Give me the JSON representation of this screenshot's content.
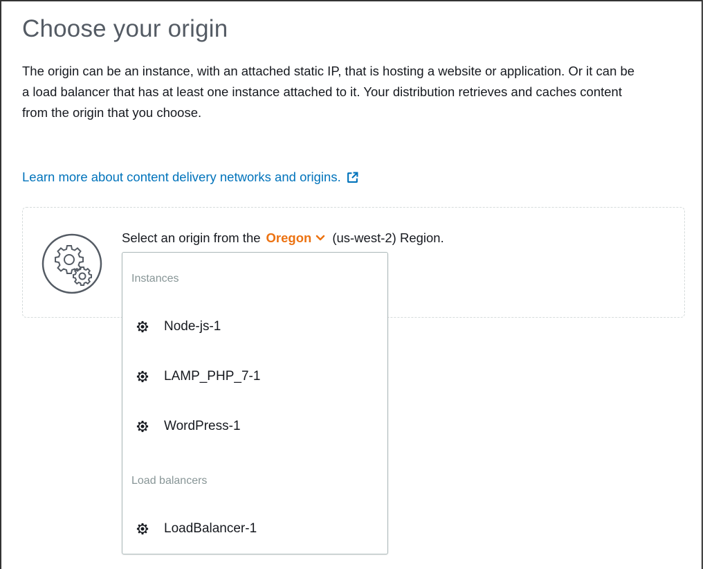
{
  "page": {
    "title": "Choose your origin",
    "description": "The origin can be an instance, with an attached static IP, that is hosting a website or application. Or it can be a load balancer that has at least one instance attached to it. Your distribution retrieves and caches content from the origin that you choose.",
    "learn_more_link": "Learn more about content delivery networks and origins."
  },
  "origin_selector": {
    "prefix": "Select an origin from the",
    "region_name": "Oregon",
    "suffix": "(us-west-2) Region.",
    "icon": "gears-icon"
  },
  "dropdown": {
    "groups": [
      {
        "label": "Instances",
        "options": [
          "Node-js-1",
          "LAMP_PHP_7-1",
          "WordPress-1"
        ]
      },
      {
        "label": "Load balancers",
        "options": [
          "LoadBalancer-1"
        ]
      }
    ],
    "option_icon": "gear-icon"
  },
  "colors": {
    "link": "#0073bb",
    "region_accent": "#ec7211",
    "title": "#545b64",
    "group_label": "#879596",
    "dropdown_border": "#aab7b8"
  }
}
